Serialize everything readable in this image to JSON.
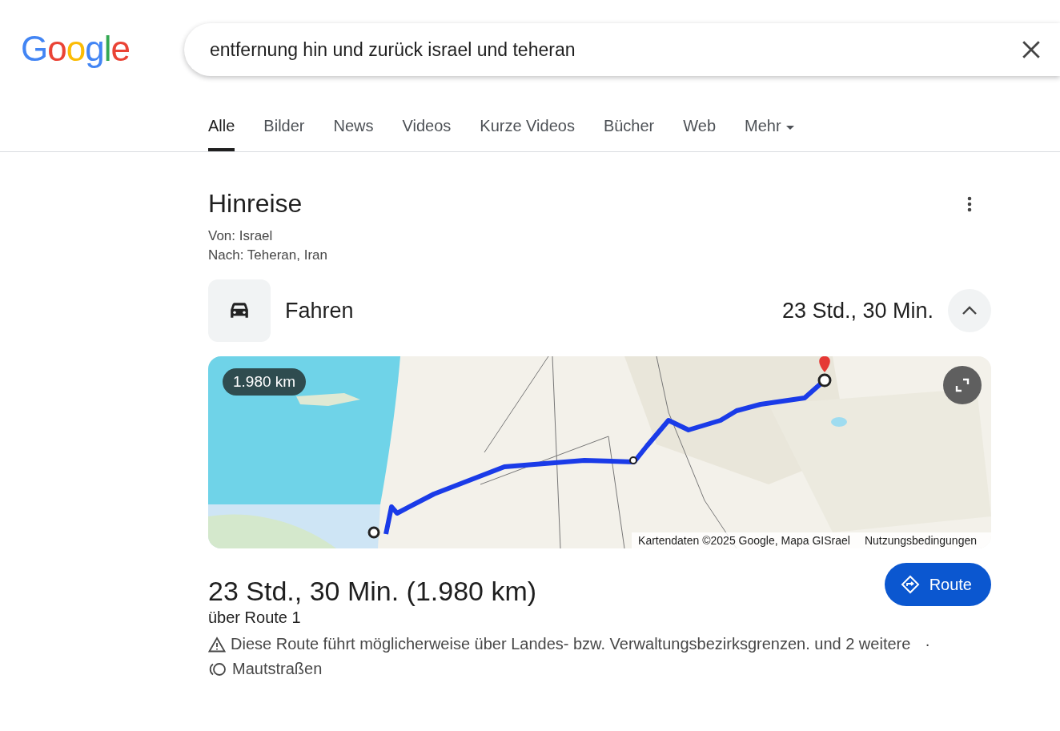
{
  "logo": "Google",
  "search": {
    "value": "entfernung hin und zurück israel und teheran"
  },
  "tabs": [
    {
      "label": "Alle",
      "selected": true
    },
    {
      "label": "Bilder",
      "selected": false
    },
    {
      "label": "News",
      "selected": false
    },
    {
      "label": "Videos",
      "selected": false
    },
    {
      "label": "Kurze Videos",
      "selected": false
    },
    {
      "label": "Bücher",
      "selected": false
    },
    {
      "label": "Web",
      "selected": false
    },
    {
      "label": "Mehr",
      "selected": false,
      "kind": "menu"
    }
  ],
  "result": {
    "title": "Hinreise",
    "from": "Von: Israel",
    "to": "Nach: Teheran, Iran",
    "mode": {
      "label": "Fahren",
      "duration": "23 Std., 30 Min.",
      "expanded": true
    },
    "map": {
      "kind": "picture",
      "distance": "1.980 km",
      "attribution": "Kartendaten ©2025 Google, Mapa GISrael",
      "terms": "Nutzungsbedingungen"
    },
    "summary": "23 Std., 30 Min. (1.980 km)",
    "via": "über Route 1",
    "route_button": "Route",
    "notes": [
      {
        "kind": "warning",
        "text": "Diese Route führt möglicherweise über Landes- bzw. Verwaltungsbezirksgrenzen. und 2 weitere",
        "separator": "·"
      },
      {
        "kind": "toll",
        "text": "Mautstraßen"
      }
    ]
  }
}
